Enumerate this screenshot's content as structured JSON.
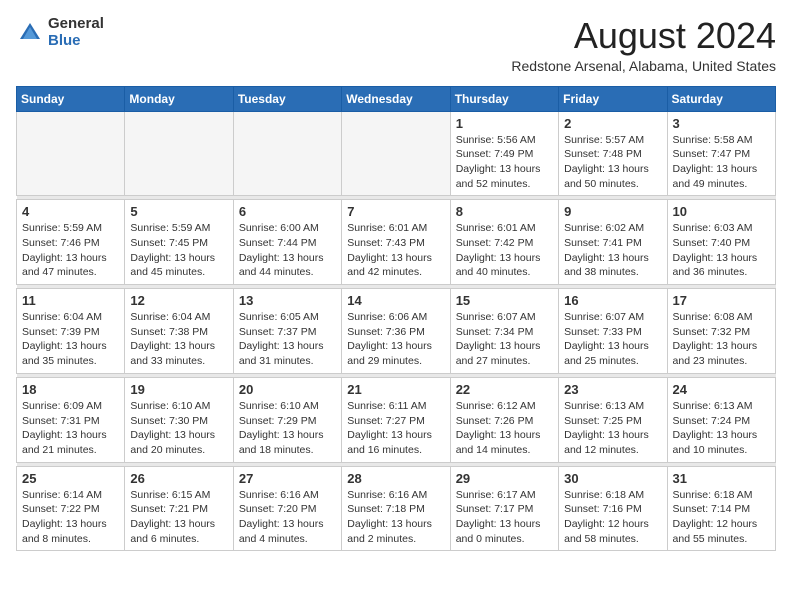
{
  "header": {
    "logo_general": "General",
    "logo_blue": "Blue",
    "month_title": "August 2024",
    "location": "Redstone Arsenal, Alabama, United States"
  },
  "weekdays": [
    "Sunday",
    "Monday",
    "Tuesday",
    "Wednesday",
    "Thursday",
    "Friday",
    "Saturday"
  ],
  "weeks": [
    [
      {
        "day": "",
        "empty": true
      },
      {
        "day": "",
        "empty": true
      },
      {
        "day": "",
        "empty": true
      },
      {
        "day": "",
        "empty": true
      },
      {
        "day": "1",
        "sunrise": "Sunrise: 5:56 AM",
        "sunset": "Sunset: 7:49 PM",
        "daylight": "Daylight: 13 hours and 52 minutes."
      },
      {
        "day": "2",
        "sunrise": "Sunrise: 5:57 AM",
        "sunset": "Sunset: 7:48 PM",
        "daylight": "Daylight: 13 hours and 50 minutes."
      },
      {
        "day": "3",
        "sunrise": "Sunrise: 5:58 AM",
        "sunset": "Sunset: 7:47 PM",
        "daylight": "Daylight: 13 hours and 49 minutes."
      }
    ],
    [
      {
        "day": "4",
        "sunrise": "Sunrise: 5:59 AM",
        "sunset": "Sunset: 7:46 PM",
        "daylight": "Daylight: 13 hours and 47 minutes."
      },
      {
        "day": "5",
        "sunrise": "Sunrise: 5:59 AM",
        "sunset": "Sunset: 7:45 PM",
        "daylight": "Daylight: 13 hours and 45 minutes."
      },
      {
        "day": "6",
        "sunrise": "Sunrise: 6:00 AM",
        "sunset": "Sunset: 7:44 PM",
        "daylight": "Daylight: 13 hours and 44 minutes."
      },
      {
        "day": "7",
        "sunrise": "Sunrise: 6:01 AM",
        "sunset": "Sunset: 7:43 PM",
        "daylight": "Daylight: 13 hours and 42 minutes."
      },
      {
        "day": "8",
        "sunrise": "Sunrise: 6:01 AM",
        "sunset": "Sunset: 7:42 PM",
        "daylight": "Daylight: 13 hours and 40 minutes."
      },
      {
        "day": "9",
        "sunrise": "Sunrise: 6:02 AM",
        "sunset": "Sunset: 7:41 PM",
        "daylight": "Daylight: 13 hours and 38 minutes."
      },
      {
        "day": "10",
        "sunrise": "Sunrise: 6:03 AM",
        "sunset": "Sunset: 7:40 PM",
        "daylight": "Daylight: 13 hours and 36 minutes."
      }
    ],
    [
      {
        "day": "11",
        "sunrise": "Sunrise: 6:04 AM",
        "sunset": "Sunset: 7:39 PM",
        "daylight": "Daylight: 13 hours and 35 minutes."
      },
      {
        "day": "12",
        "sunrise": "Sunrise: 6:04 AM",
        "sunset": "Sunset: 7:38 PM",
        "daylight": "Daylight: 13 hours and 33 minutes."
      },
      {
        "day": "13",
        "sunrise": "Sunrise: 6:05 AM",
        "sunset": "Sunset: 7:37 PM",
        "daylight": "Daylight: 13 hours and 31 minutes."
      },
      {
        "day": "14",
        "sunrise": "Sunrise: 6:06 AM",
        "sunset": "Sunset: 7:36 PM",
        "daylight": "Daylight: 13 hours and 29 minutes."
      },
      {
        "day": "15",
        "sunrise": "Sunrise: 6:07 AM",
        "sunset": "Sunset: 7:34 PM",
        "daylight": "Daylight: 13 hours and 27 minutes."
      },
      {
        "day": "16",
        "sunrise": "Sunrise: 6:07 AM",
        "sunset": "Sunset: 7:33 PM",
        "daylight": "Daylight: 13 hours and 25 minutes."
      },
      {
        "day": "17",
        "sunrise": "Sunrise: 6:08 AM",
        "sunset": "Sunset: 7:32 PM",
        "daylight": "Daylight: 13 hours and 23 minutes."
      }
    ],
    [
      {
        "day": "18",
        "sunrise": "Sunrise: 6:09 AM",
        "sunset": "Sunset: 7:31 PM",
        "daylight": "Daylight: 13 hours and 21 minutes."
      },
      {
        "day": "19",
        "sunrise": "Sunrise: 6:10 AM",
        "sunset": "Sunset: 7:30 PM",
        "daylight": "Daylight: 13 hours and 20 minutes."
      },
      {
        "day": "20",
        "sunrise": "Sunrise: 6:10 AM",
        "sunset": "Sunset: 7:29 PM",
        "daylight": "Daylight: 13 hours and 18 minutes."
      },
      {
        "day": "21",
        "sunrise": "Sunrise: 6:11 AM",
        "sunset": "Sunset: 7:27 PM",
        "daylight": "Daylight: 13 hours and 16 minutes."
      },
      {
        "day": "22",
        "sunrise": "Sunrise: 6:12 AM",
        "sunset": "Sunset: 7:26 PM",
        "daylight": "Daylight: 13 hours and 14 minutes."
      },
      {
        "day": "23",
        "sunrise": "Sunrise: 6:13 AM",
        "sunset": "Sunset: 7:25 PM",
        "daylight": "Daylight: 13 hours and 12 minutes."
      },
      {
        "day": "24",
        "sunrise": "Sunrise: 6:13 AM",
        "sunset": "Sunset: 7:24 PM",
        "daylight": "Daylight: 13 hours and 10 minutes."
      }
    ],
    [
      {
        "day": "25",
        "sunrise": "Sunrise: 6:14 AM",
        "sunset": "Sunset: 7:22 PM",
        "daylight": "Daylight: 13 hours and 8 minutes."
      },
      {
        "day": "26",
        "sunrise": "Sunrise: 6:15 AM",
        "sunset": "Sunset: 7:21 PM",
        "daylight": "Daylight: 13 hours and 6 minutes."
      },
      {
        "day": "27",
        "sunrise": "Sunrise: 6:16 AM",
        "sunset": "Sunset: 7:20 PM",
        "daylight": "Daylight: 13 hours and 4 minutes."
      },
      {
        "day": "28",
        "sunrise": "Sunrise: 6:16 AM",
        "sunset": "Sunset: 7:18 PM",
        "daylight": "Daylight: 13 hours and 2 minutes."
      },
      {
        "day": "29",
        "sunrise": "Sunrise: 6:17 AM",
        "sunset": "Sunset: 7:17 PM",
        "daylight": "Daylight: 13 hours and 0 minutes."
      },
      {
        "day": "30",
        "sunrise": "Sunrise: 6:18 AM",
        "sunset": "Sunset: 7:16 PM",
        "daylight": "Daylight: 12 hours and 58 minutes."
      },
      {
        "day": "31",
        "sunrise": "Sunrise: 6:18 AM",
        "sunset": "Sunset: 7:14 PM",
        "daylight": "Daylight: 12 hours and 55 minutes."
      }
    ]
  ]
}
